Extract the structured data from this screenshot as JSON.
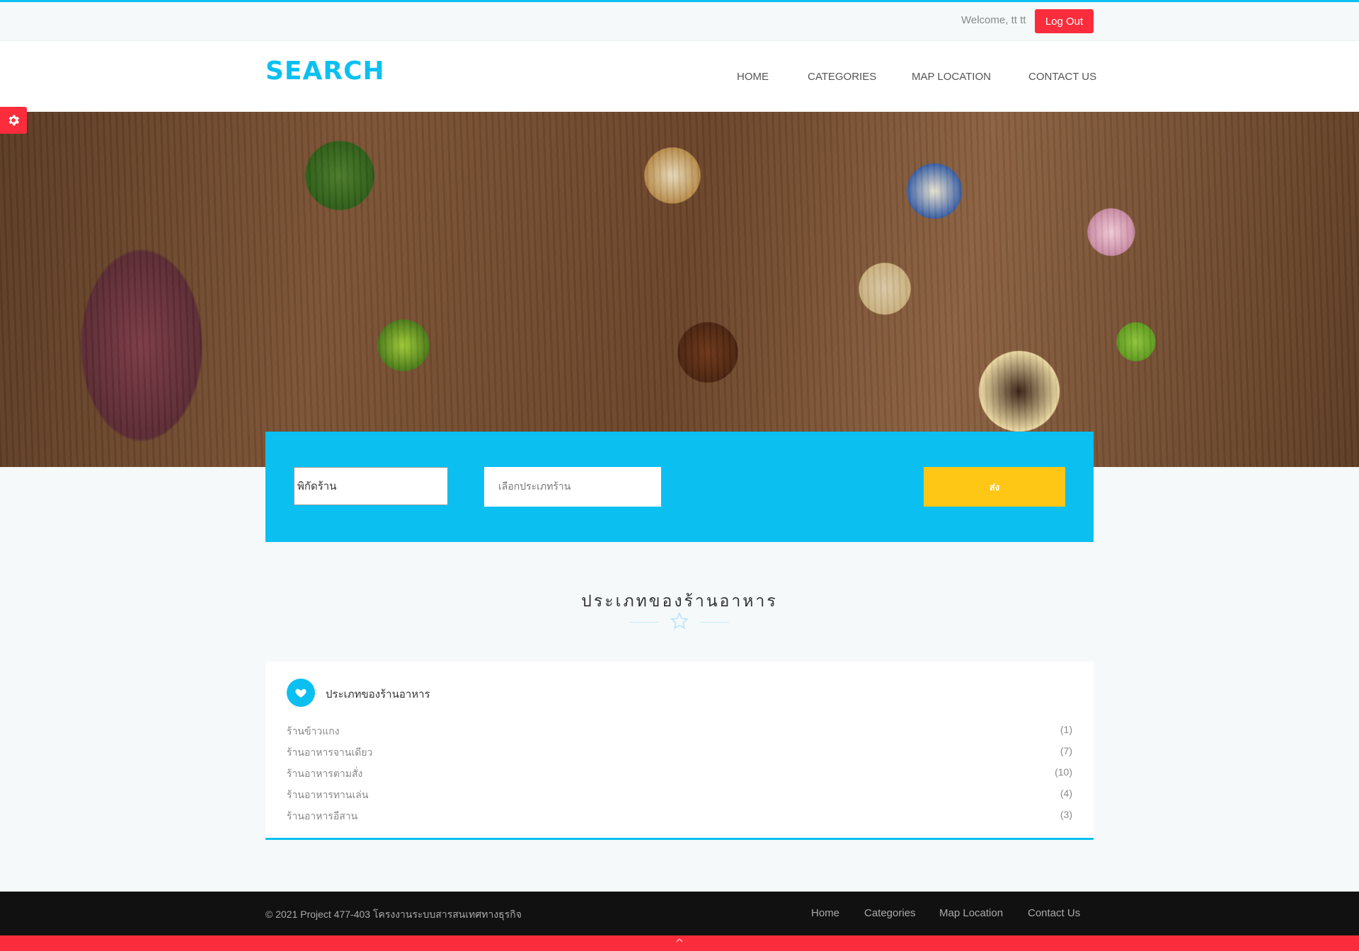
{
  "topbar": {
    "welcome": "Welcome, tt tt",
    "logout_label": "Log Out"
  },
  "brand": {
    "logo": "SEARCH"
  },
  "nav": {
    "home": "HOME",
    "categories": "CATEGORIES",
    "map": "MAP LOCATION",
    "contact": "CONTACT US"
  },
  "search": {
    "location_value": "พิกัดร้าน",
    "type_placeholder": "เลือกประเภทร้าน",
    "submit_label": "ส่ง"
  },
  "section": {
    "title": "ประเภทของร้านอาหาร"
  },
  "card": {
    "title": "ประเภทของร้านอาหาร",
    "categories": [
      {
        "name": "ร้านข้าวแกง",
        "count": "(1)"
      },
      {
        "name": "ร้านอาหารจานเดียว",
        "count": "(7)"
      },
      {
        "name": "ร้านอาหารตามสั่ง",
        "count": "(10)"
      },
      {
        "name": "ร้านอาหารทานเล่น",
        "count": "(4)"
      },
      {
        "name": "ร้านอาหารอีสาน",
        "count": "(3)"
      }
    ]
  },
  "footer": {
    "copyright": "© 2021 Project 477-403 โครงงานระบบสารสนเทศทางธุรกิจ",
    "home": "Home",
    "categories": "Categories",
    "map": "Map Location",
    "contact": "Contact Us"
  },
  "icons": {
    "settings": "gear-icon",
    "category": "heart-icon",
    "divider": "star-icon",
    "back_to_top": "chevron-up-icon"
  },
  "colors": {
    "accent": "#0bc0f1",
    "danger": "#fb2d3c",
    "button": "#fec716",
    "footer": "#111111"
  }
}
